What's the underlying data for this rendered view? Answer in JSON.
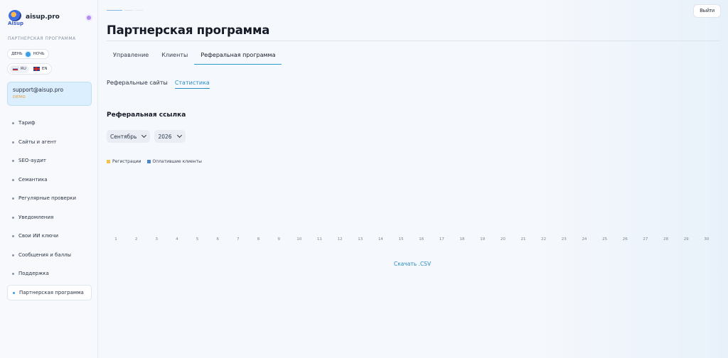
{
  "brand": {
    "name": "aisup.pro",
    "logo_text": "Aisup"
  },
  "sidebar": {
    "caption": "ПАРТНЕРСКАЯ ПРОГРАММА",
    "theme": {
      "day": "ДЕНЬ",
      "night": "НОЧЬ"
    },
    "langs": [
      {
        "label": "RU"
      },
      {
        "label": "EN"
      }
    ],
    "account": {
      "email": "support@aisup.pro",
      "badge": "DEMO"
    },
    "items": [
      {
        "label": "Тариф"
      },
      {
        "label": "Сайты и агент"
      },
      {
        "label": "SEO-аудит"
      },
      {
        "label": "Семантика"
      },
      {
        "label": "Регулярные проверки"
      },
      {
        "label": "Уведомления"
      },
      {
        "label": "Свои ИИ ключи"
      },
      {
        "label": "Сообщения и баллы"
      },
      {
        "label": "Поддержка"
      },
      {
        "label": "Партнерская программа"
      }
    ]
  },
  "header": {
    "title": "Партнерская программа",
    "logout_label": "Выйти"
  },
  "tabs": [
    {
      "label": "Управление"
    },
    {
      "label": "Клиенты"
    },
    {
      "label": "Реферальная программа"
    }
  ],
  "subtabs": [
    {
      "label": "Реферальные сайты"
    },
    {
      "label": "Статистика"
    }
  ],
  "section": {
    "title": "Реферальная ссылка"
  },
  "filters": {
    "month": "Сентябрь",
    "year": "2026"
  },
  "download_label": "Скачать .CSV",
  "colors": {
    "accent": "#2a8cc2",
    "registrations": "#f2c14e",
    "paid_clients": "#4a86c8"
  },
  "chart_data": {
    "type": "bar",
    "categories": [
      "1",
      "2",
      "3",
      "4",
      "5",
      "6",
      "7",
      "8",
      "9",
      "10",
      "11",
      "12",
      "13",
      "14",
      "15",
      "16",
      "17",
      "18",
      "19",
      "20",
      "21",
      "22",
      "23",
      "24",
      "25",
      "26",
      "27",
      "28",
      "29",
      "30"
    ],
    "series": [
      {
        "name": "Регистрации",
        "values": [
          0,
          0,
          0,
          0,
          0,
          0,
          0,
          0,
          0,
          0,
          0,
          0,
          0,
          0,
          0,
          0,
          0,
          0,
          0,
          0,
          0,
          0,
          0,
          0,
          0,
          0,
          0,
          0,
          0,
          0
        ]
      },
      {
        "name": "Оплатившие клиенты",
        "values": [
          0,
          0,
          0,
          0,
          0,
          0,
          0,
          0,
          0,
          0,
          0,
          0,
          0,
          0,
          0,
          0,
          0,
          0,
          0,
          0,
          0,
          0,
          0,
          0,
          0,
          0,
          0,
          0,
          0,
          0
        ]
      }
    ],
    "legend": "top-left",
    "grid": false
  }
}
